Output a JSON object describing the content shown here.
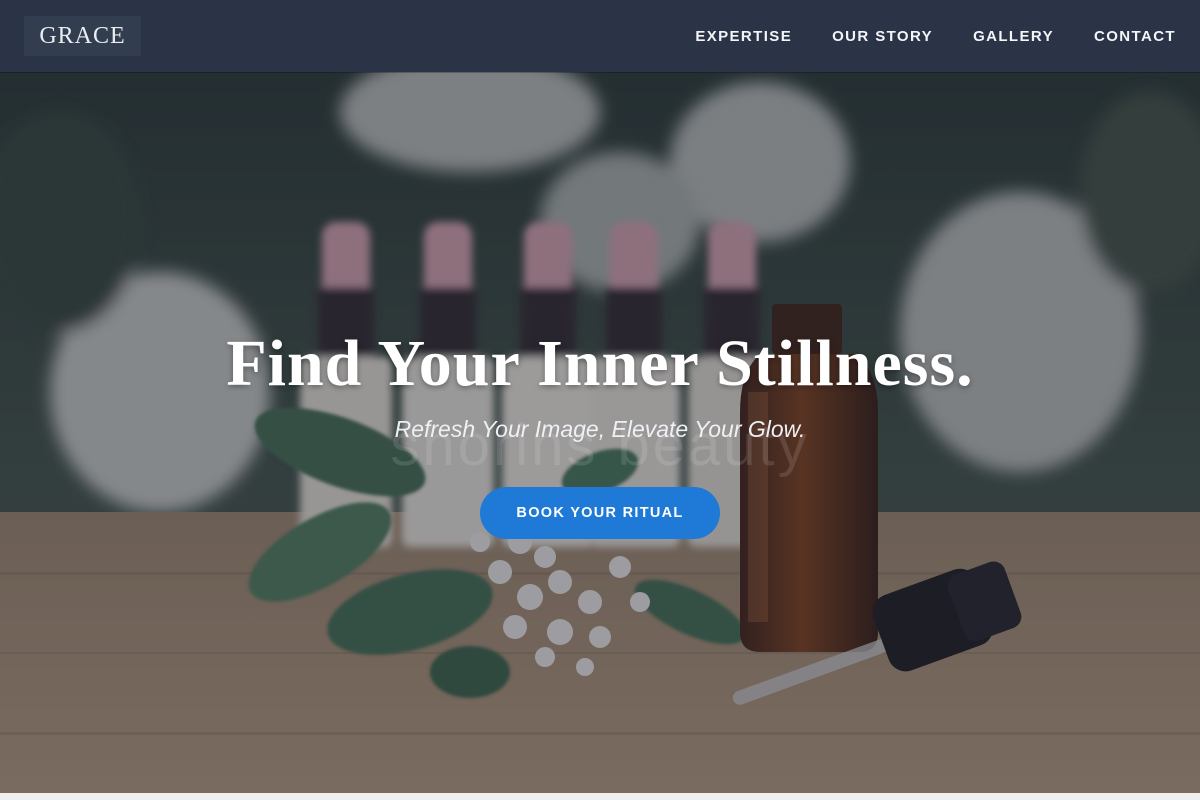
{
  "nav": {
    "logo": "GRACE",
    "items": [
      {
        "label": "EXPERTISE"
      },
      {
        "label": "OUR STORY"
      },
      {
        "label": "GALLERY"
      },
      {
        "label": "CONTACT"
      }
    ]
  },
  "hero": {
    "headline": "Find Your Inner Stillness.",
    "tagline": "Refresh Your Image, Elevate Your Glow.",
    "cta_label": "BOOK YOUR RITUAL",
    "background_text": "shorins beauty"
  },
  "colors": {
    "nav_bg": "#2a3446",
    "cta": "#1e7ad6",
    "overlay": "#282c3c"
  }
}
